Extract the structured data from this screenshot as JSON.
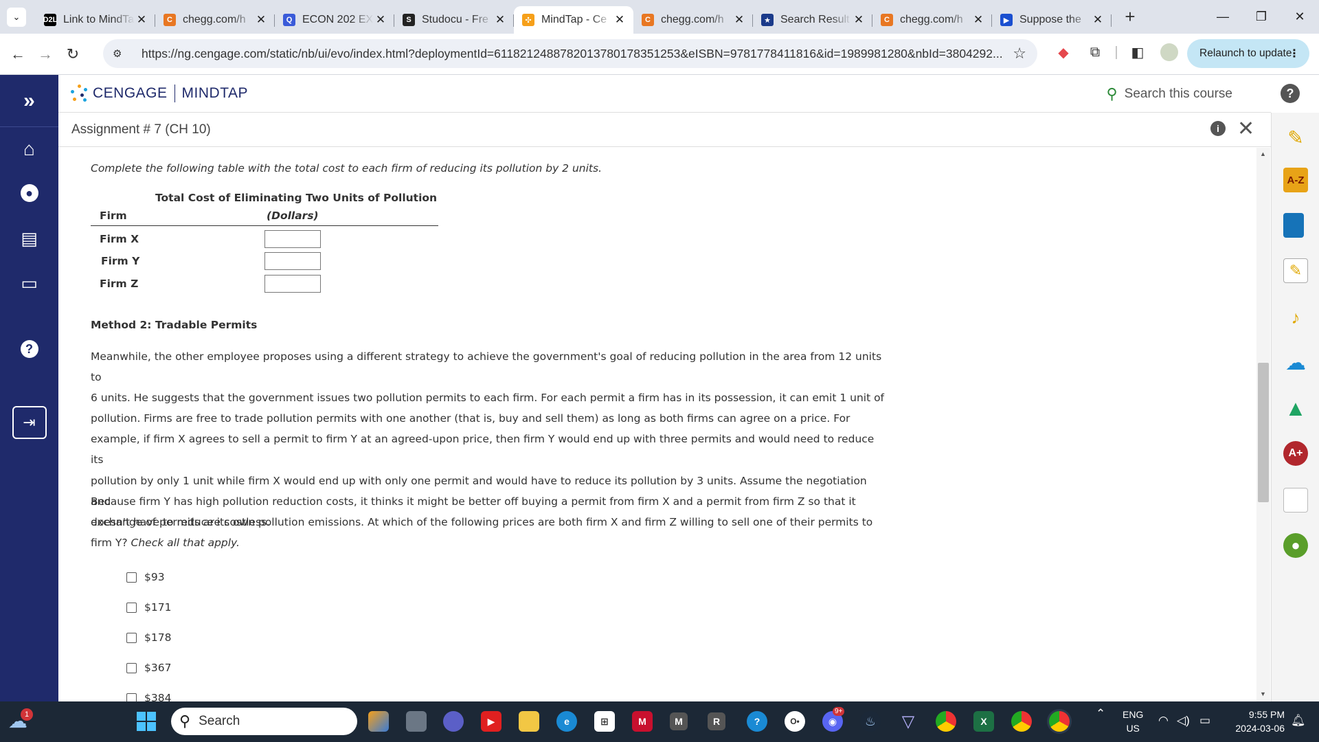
{
  "browser": {
    "tabs": [
      {
        "label": "Link to MindTap",
        "favicon": "d2l-icon",
        "fav_text": "D2L",
        "fav_color": "#000000"
      },
      {
        "label": "chegg.com/h",
        "favicon": "chegg-icon",
        "fav_text": "C",
        "fav_color": "#e87722"
      },
      {
        "label": "ECON 202 EX",
        "favicon": "search-q-icon",
        "fav_text": "Q",
        "fav_color": "#3a5bd9"
      },
      {
        "label": "Studocu - Fre",
        "favicon": "studocu-icon",
        "fav_text": "S",
        "fav_color": "#222222"
      },
      {
        "label": "MindTap - Ce",
        "favicon": "cengage-icon",
        "fav_text": "✣",
        "fav_color": "#f6a01a",
        "active": true
      },
      {
        "label": "chegg.com/h",
        "favicon": "chegg-icon",
        "fav_text": "C",
        "fav_color": "#e87722"
      },
      {
        "label": "Search Result",
        "favicon": "star-icon",
        "fav_text": "★",
        "fav_color": "#1a3a8a"
      },
      {
        "label": "chegg.com/h",
        "favicon": "chegg-icon",
        "fav_text": "C",
        "fav_color": "#e87722"
      },
      {
        "label": "Suppose the",
        "favicon": "play-icon",
        "fav_text": "▶",
        "fav_color": "#1a4fd0"
      }
    ],
    "url": "https://ng.cengage.com/static/nb/ui/evo/index.html?deploymentId=6118212488782013780178351253&eISBN=9781778411816&id=1989981280&nbId=3804292...",
    "relaunch_label": "Relaunch to update"
  },
  "app": {
    "brand": "CENGAGE",
    "product": "MINDTAP",
    "search_placeholder": "Search this course",
    "assignment_title": "Assignment # 7 (CH 10)"
  },
  "content": {
    "intro": "Complete the following table with the total cost to each firm of reducing its pollution by 2 units.",
    "table_title": "Total Cost of Eliminating Two Units of Pollution",
    "col_firm": "Firm",
    "col_unit": "(Dollars)",
    "rows": [
      {
        "firm": "Firm X",
        "value": ""
      },
      {
        "firm": "Firm Y",
        "value": ""
      },
      {
        "firm": "Firm Z",
        "value": ""
      }
    ],
    "method_heading": "Method 2: Tradable Permits",
    "para1_lines": [
      "Meanwhile, the other employee proposes using a different strategy to achieve the government's goal of reducing pollution in the area from 12 units to",
      "6 units. He suggests that the government issues two pollution permits to each firm. For each permit a firm has in its possession, it can emit 1 unit of",
      "pollution. Firms are free to trade pollution permits with one another (that is, buy and sell them) as long as both firms can agree on a price. For",
      "example, if firm X agrees to sell a permit to firm Y at an agreed-upon price, then firm Y would end up with three permits and would need to reduce its",
      "pollution by only 1 unit while firm X would end up with only one permit and would have to reduce its pollution by 3 units. Assume the negotiation and",
      "exchange of permits are costless."
    ],
    "para2_lines": [
      "Because firm Y has high pollution reduction costs, it thinks it might be better off buying a permit from firm X and a permit from firm Z so that it",
      "doesn't have to reduce its own pollution emissions. At which of the following prices are both firm X and firm Z willing to sell one of their permits to"
    ],
    "para2_last": "firm Y? ",
    "para2_italic": "Check all that apply.",
    "options": [
      "$93",
      "$171",
      "$178",
      "$367",
      "$384"
    ]
  },
  "taskbar": {
    "search_label": "Search",
    "lang_top": "ENG",
    "lang_bottom": "US",
    "time": "9:55 PM",
    "date": "2024-03-06",
    "weather_badge": "1",
    "discord_badge": "9+"
  }
}
